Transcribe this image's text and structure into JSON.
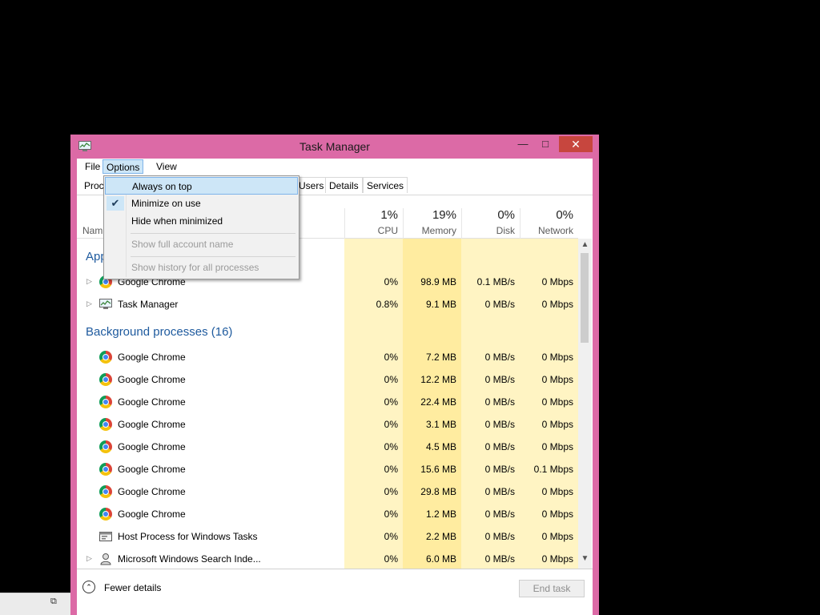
{
  "window": {
    "title": "Task Manager",
    "minimize_glyph": "—",
    "maximize_glyph": "□",
    "close_glyph": "✕",
    "frame_color": "#dc6aa6"
  },
  "menubar": {
    "file": "File",
    "options": "Options",
    "view": "View"
  },
  "tabs": {
    "processes": "Proc",
    "users": "Users",
    "details": "Details",
    "services": "Services"
  },
  "columns": {
    "name": "Nam",
    "cpu": {
      "pct": "1%",
      "label": "CPU"
    },
    "memory": {
      "pct": "19%",
      "label": "Memory"
    },
    "disk": {
      "pct": "0%",
      "label": "Disk"
    },
    "network": {
      "pct": "0%",
      "label": "Network"
    }
  },
  "groups": {
    "apps": "App",
    "background": "Background processes (16)"
  },
  "apps": [
    {
      "name": "Google Chrome",
      "cpu": "0%",
      "memory": "98.9 MB",
      "disk": "0.1 MB/s",
      "network": "0 Mbps",
      "icon": "chrome-icon"
    },
    {
      "name": "Task Manager",
      "cpu": "0.8%",
      "memory": "9.1 MB",
      "disk": "0 MB/s",
      "network": "0 Mbps",
      "icon": "task-manager-icon"
    }
  ],
  "background": [
    {
      "name": "Google Chrome",
      "cpu": "0%",
      "memory": "7.2 MB",
      "disk": "0 MB/s",
      "network": "0 Mbps"
    },
    {
      "name": "Google Chrome",
      "cpu": "0%",
      "memory": "12.2 MB",
      "disk": "0 MB/s",
      "network": "0 Mbps"
    },
    {
      "name": "Google Chrome",
      "cpu": "0%",
      "memory": "22.4 MB",
      "disk": "0 MB/s",
      "network": "0 Mbps"
    },
    {
      "name": "Google Chrome",
      "cpu": "0%",
      "memory": "3.1 MB",
      "disk": "0 MB/s",
      "network": "0 Mbps"
    },
    {
      "name": "Google Chrome",
      "cpu": "0%",
      "memory": "4.5 MB",
      "disk": "0 MB/s",
      "network": "0 Mbps"
    },
    {
      "name": "Google Chrome",
      "cpu": "0%",
      "memory": "15.6 MB",
      "disk": "0 MB/s",
      "network": "0.1 Mbps"
    },
    {
      "name": "Google Chrome",
      "cpu": "0%",
      "memory": "29.8 MB",
      "disk": "0 MB/s",
      "network": "0 Mbps"
    },
    {
      "name": "Google Chrome",
      "cpu": "0%",
      "memory": "1.2 MB",
      "disk": "0 MB/s",
      "network": "0 Mbps"
    },
    {
      "name": "Host Process for Windows Tasks",
      "cpu": "0%",
      "memory": "2.2 MB",
      "disk": "0 MB/s",
      "network": "0 Mbps"
    },
    {
      "name": "Microsoft Windows Search Inde...",
      "cpu": "0%",
      "memory": "6.0 MB",
      "disk": "0 MB/s",
      "network": "0 Mbps"
    }
  ],
  "options_menu": {
    "always_on_top": "Always on top",
    "minimize_on_use": "Minimize on use",
    "minimize_on_use_checked": true,
    "hide_when_minimized": "Hide when minimized",
    "show_full_account_name": "Show full account name",
    "show_history": "Show history for all processes"
  },
  "footer": {
    "fewer_details": "Fewer details",
    "end_task": "End task"
  },
  "glyphs": {
    "expander": "▷",
    "check": "✔",
    "scroll_up": "▲",
    "scroll_down": "▼",
    "fewer": "⌃",
    "restore": "⧉"
  }
}
